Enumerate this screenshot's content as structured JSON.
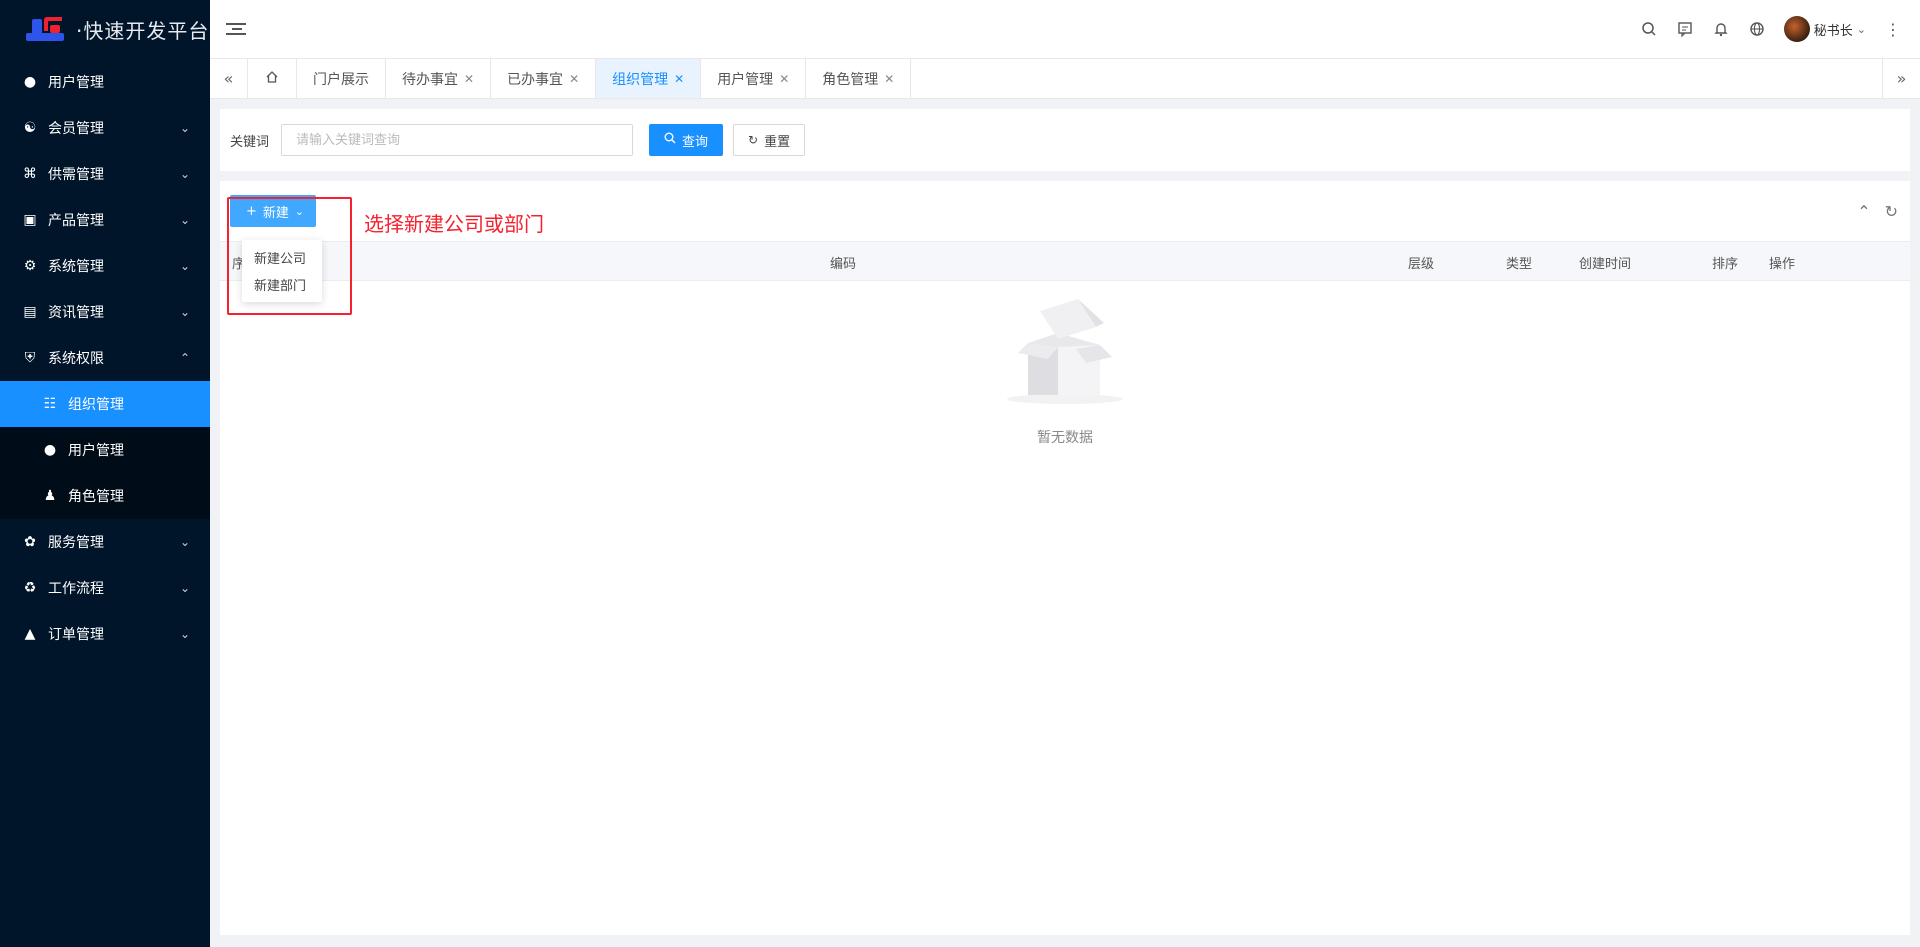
{
  "app": {
    "title": "·快速开发平台"
  },
  "sidebar": {
    "items": [
      {
        "label": "用户管理",
        "icon": "user-icon",
        "expandable": false
      },
      {
        "label": "会员管理",
        "icon": "members-icon",
        "expandable": true
      },
      {
        "label": "供需管理",
        "icon": "clover-icon",
        "expandable": true
      },
      {
        "label": "产品管理",
        "icon": "product-icon",
        "expandable": true
      },
      {
        "label": "系统管理",
        "icon": "gear-icon",
        "expandable": true
      },
      {
        "label": "资讯管理",
        "icon": "document-icon",
        "expandable": true
      },
      {
        "label": "系统权限",
        "icon": "shield-icon",
        "expandable": true,
        "expanded": true
      },
      {
        "label": "服务管理",
        "icon": "apps-icon",
        "expandable": true
      },
      {
        "label": "工作流程",
        "icon": "workflow-icon",
        "expandable": true
      },
      {
        "label": "订单管理",
        "icon": "triangle-icon",
        "expandable": true
      }
    ],
    "submenu": [
      {
        "label": "组织管理",
        "icon": "org-icon",
        "active": true
      },
      {
        "label": "用户管理",
        "icon": "user-icon",
        "active": false
      },
      {
        "label": "角色管理",
        "icon": "role-icon",
        "active": false
      }
    ]
  },
  "header": {
    "username": "秘书长"
  },
  "tabs": [
    {
      "label": "门户展示",
      "closable": false
    },
    {
      "label": "待办事宜",
      "closable": true
    },
    {
      "label": "已办事宜",
      "closable": true
    },
    {
      "label": "组织管理",
      "closable": true,
      "active": true
    },
    {
      "label": "用户管理",
      "closable": true
    },
    {
      "label": "角色管理",
      "closable": true
    }
  ],
  "search": {
    "label": "关键词",
    "placeholder": "请输入关键词查询",
    "value": "",
    "query_label": "查询",
    "reset_label": "重置"
  },
  "table": {
    "new_label": "新建",
    "annotation": "选择新建公司或部门",
    "columns": [
      "序",
      "编码",
      "层级",
      "类型",
      "创建时间",
      "排序",
      "操作"
    ],
    "empty_text": "暂无数据",
    "dropdown": [
      "新建公司",
      "新建部门"
    ]
  },
  "colors": {
    "primary": "#1890ff",
    "sidebar_bg": "#001529",
    "annotation": "#f5222d"
  }
}
